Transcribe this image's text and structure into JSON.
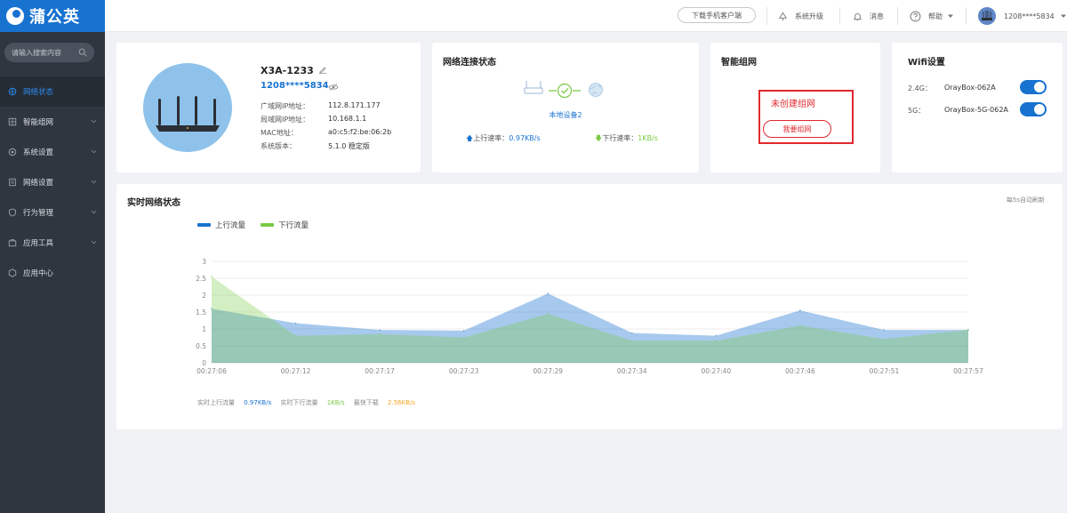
{
  "brand": {
    "name": "蒲公英"
  },
  "search": {
    "placeholder": "请输入搜索内容"
  },
  "sidebar": {
    "items": [
      {
        "label": "网络状态",
        "active": true
      },
      {
        "label": "智能组网"
      },
      {
        "label": "系统设置"
      },
      {
        "label": "网络设置"
      },
      {
        "label": "行为管理"
      },
      {
        "label": "应用工具"
      },
      {
        "label": "应用中心"
      }
    ]
  },
  "topbar": {
    "download_label": "下载手机客户端",
    "upgrade_label": "系统升级",
    "messages_label": "消息",
    "help_label": "帮助",
    "user_label": "1208****5834"
  },
  "device": {
    "name": "X3A-1233",
    "id": "1208****5834",
    "rows": [
      {
        "label": "广域网IP地址：",
        "value": "112.8.171.177"
      },
      {
        "label": "局域网IP地址：",
        "value": "10.168.1.1"
      },
      {
        "label": "MAC地址：",
        "value": "a0:c5:f2:be:06:2b"
      },
      {
        "label": "系统版本：",
        "value": "5.1.0 稳定版"
      }
    ]
  },
  "network_status": {
    "title": "网络连接状态",
    "local_devices": "本地设备2",
    "up_label": "上行速率：",
    "up_value": "0.97KB/s",
    "down_label": "下行速率：",
    "down_value": "1KB/s"
  },
  "mesh": {
    "title": "智能组网",
    "status": "未创建组网",
    "button": "我要组网"
  },
  "wifi": {
    "title": "Wifi设置",
    "bands": [
      {
        "band": "2.4G：",
        "ssid": "OrayBox-062A",
        "enabled": true
      },
      {
        "band": "5G：",
        "ssid": "OrayBox-5G-062A",
        "enabled": true
      }
    ]
  },
  "realtime": {
    "title": "实时网络状态",
    "refresh_note": "每5s自动刷新",
    "stats": {
      "up_label": "实时上行流量",
      "up_value": "0.97KB/s",
      "down_label": "实时下行流量",
      "down_value": "1KB/s",
      "peak_label": "最快下载",
      "peak_value": "2.56KB/s"
    }
  },
  "colors": {
    "brand": "#1772d0",
    "upload": "#1772d0",
    "download": "#7ac943",
    "alert": "#e0282e"
  },
  "chart_data": {
    "type": "area",
    "x": [
      "00:27:06",
      "00:27:12",
      "00:27:17",
      "00:27:23",
      "00:27:29",
      "00:27:34",
      "00:27:40",
      "00:27:46",
      "00:27:51",
      "00:27:57"
    ],
    "y_ticks": [
      "0",
      "0.5",
      "1",
      "1.5",
      "2",
      "2.5",
      "3"
    ],
    "ylim": [
      0,
      3
    ],
    "grid": true,
    "legend": "top-left",
    "series": [
      {
        "name": "上行流量",
        "color": "#1772d0",
        "values": [
          1.6,
          1.17,
          0.97,
          0.95,
          2.05,
          0.88,
          0.8,
          1.55,
          0.97,
          0.97
        ]
      },
      {
        "name": "下行流量",
        "color": "#7ac943",
        "values": [
          2.55,
          0.8,
          0.85,
          0.75,
          1.45,
          0.65,
          0.65,
          1.1,
          0.7,
          0.98
        ]
      }
    ]
  }
}
